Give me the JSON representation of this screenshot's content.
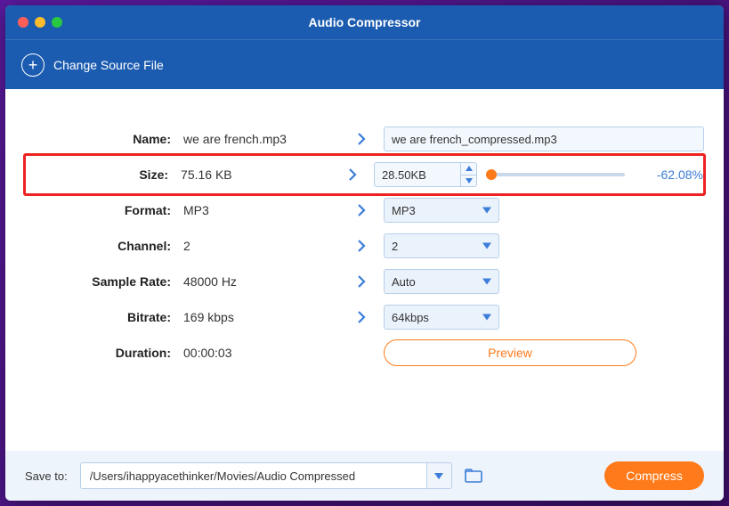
{
  "window": {
    "title": "Audio Compressor"
  },
  "toolbar": {
    "change_source": "Change Source File"
  },
  "rows": {
    "name": {
      "label": "Name:",
      "orig": "we are french.mp3",
      "out": "we are french_compressed.mp3"
    },
    "size": {
      "label": "Size:",
      "orig": "75.16 KB",
      "out": "28.50KB",
      "pct": "-62.08%"
    },
    "format": {
      "label": "Format:",
      "orig": "MP3",
      "out": "MP3"
    },
    "channel": {
      "label": "Channel:",
      "orig": "2",
      "out": "2"
    },
    "sample_rate": {
      "label": "Sample Rate:",
      "orig": "48000 Hz",
      "out": "Auto"
    },
    "bitrate": {
      "label": "Bitrate:",
      "orig": "169 kbps",
      "out": "64kbps"
    },
    "duration": {
      "label": "Duration:",
      "orig": "00:00:03"
    }
  },
  "buttons": {
    "preview": "Preview",
    "compress": "Compress"
  },
  "footer": {
    "save_label": "Save to:",
    "path": "/Users/ihappyacethinker/Movies/Audio Compressed"
  }
}
